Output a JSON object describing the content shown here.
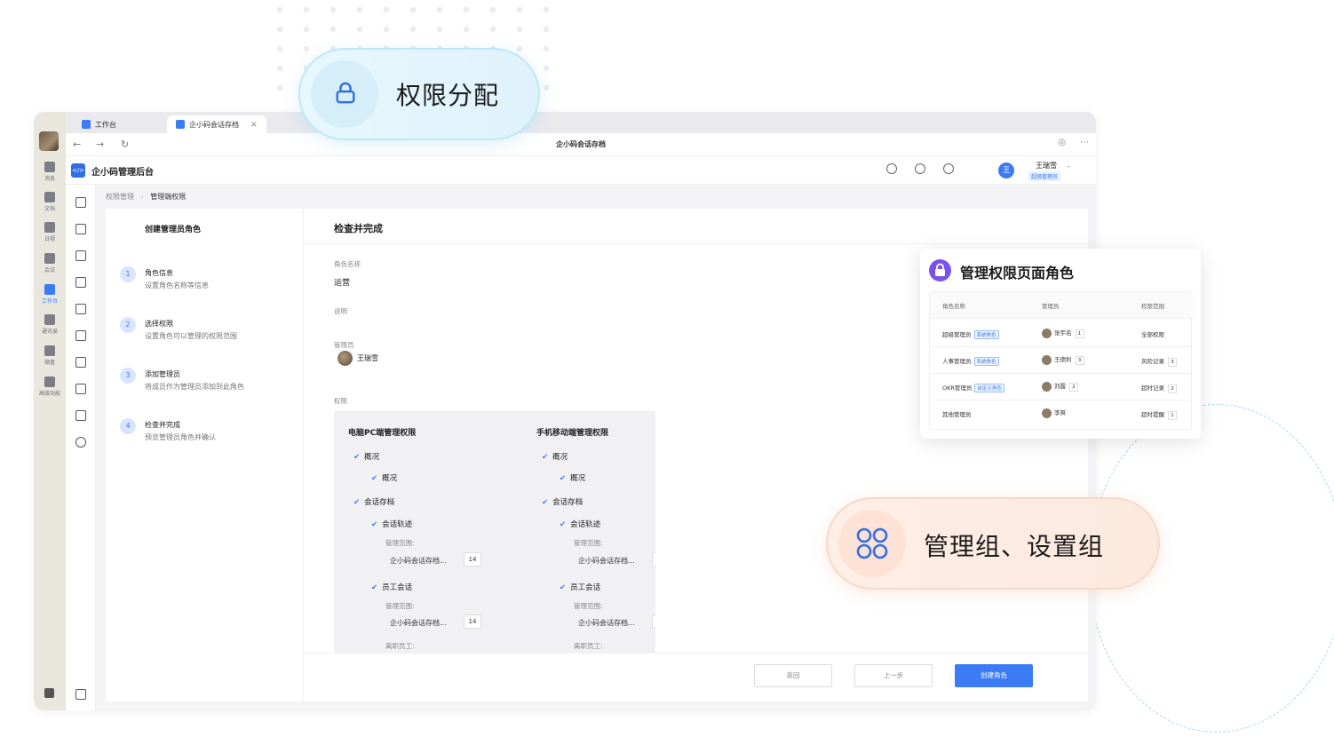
{
  "floating": {
    "permission_pill": "权限分配",
    "group_pill": "管理组、设置组"
  },
  "rail": {
    "items": [
      {
        "label": "消息",
        "icon": "message-icon"
      },
      {
        "label": "文档",
        "icon": "document-icon"
      },
      {
        "label": "日程",
        "icon": "calendar-icon"
      },
      {
        "label": "会议",
        "icon": "meeting-icon"
      },
      {
        "label": "工作台",
        "icon": "workbench-icon"
      },
      {
        "label": "通讯录",
        "icon": "contacts-icon"
      },
      {
        "label": "微盘",
        "icon": "drive-icon"
      },
      {
        "label": "高级功能",
        "icon": "advanced-icon"
      }
    ]
  },
  "browser": {
    "tab1": "工作台",
    "tab2": "企小码会话存档",
    "address_title": "企小码会话存档"
  },
  "header": {
    "app_title": "企小码管理后台",
    "user_name": "王瑞雪",
    "user_role": "超级管理员",
    "user_avatar_char": "王"
  },
  "breadcrumb": {
    "parent": "权限管理",
    "current": "管理端权限"
  },
  "steps": {
    "title": "创建管理员角色",
    "items": [
      {
        "num": "1",
        "title": "角色信息",
        "desc": "设置角色名称等信息"
      },
      {
        "num": "2",
        "title": "选择权限",
        "desc": "设置角色可以管理的权限范围"
      },
      {
        "num": "3",
        "title": "添加管理员",
        "desc": "将成员作为管理员添加到此角色"
      },
      {
        "num": "4",
        "title": "检查并完成",
        "desc": "预览管理员角色并确认"
      }
    ]
  },
  "main": {
    "title": "检查并完成",
    "role_name_label": "角色名称",
    "role_name_value": "运营",
    "desc_label": "说明",
    "admin_label": "管理员",
    "admin_name": "王瑞雪",
    "perm_label": "权限"
  },
  "permissions": {
    "pc": {
      "title": "电脑PC端管理权限",
      "overview": "概况",
      "overview_sub": "概况",
      "archive": "会话存档",
      "track": "会话轨迹",
      "scope_label": "管理范围:",
      "scope_value": "企小码会话存档...",
      "scope_count": "14",
      "staff": "员工会话",
      "scope_label2": "管理范围:",
      "scope_value2": "企小码会话存档...",
      "scope_count2": "14",
      "resigned": "离职员工:"
    },
    "mobile": {
      "title": "手机移动端管理权限",
      "overview": "概况",
      "overview_sub": "概况",
      "archive": "会话存档",
      "track": "会话轨迹",
      "scope_label": "管理范围:",
      "scope_value": "企小码会话存档...",
      "scope_count": "14",
      "staff": "员工会话",
      "scope_label2": "管理范围:",
      "scope_value2": "企小码会话存档...",
      "scope_count2": "14",
      "resigned": "离职员工:"
    }
  },
  "footer": {
    "back": "返回",
    "prev": "上一步",
    "create": "创建角色"
  },
  "popup": {
    "title": "管理权限页面角色",
    "headers": [
      "角色名称",
      "管理员",
      "权限范围"
    ],
    "rows": [
      {
        "role": "超级管理员",
        "tag": "系统角色",
        "admin": "张宇名",
        "admin_count": "1",
        "scope": "全部权限",
        "scope_count": ""
      },
      {
        "role": "人事管理员",
        "tag": "系统角色",
        "admin": "王德利",
        "admin_count": "3",
        "scope": "风险记录",
        "scope_count": "3"
      },
      {
        "role": "OKR管理员",
        "tag": "自定义角色",
        "admin": "刘霞",
        "admin_count": "2",
        "scope": "超时记录",
        "scope_count": "2"
      },
      {
        "role": "其他管理员",
        "tag": "",
        "admin": "李爽",
        "admin_count": "",
        "scope": "超时提醒",
        "scope_count": "1"
      }
    ]
  },
  "colors": {
    "accent": "#3b7bf6",
    "popup_icon": "#7a52ea"
  }
}
